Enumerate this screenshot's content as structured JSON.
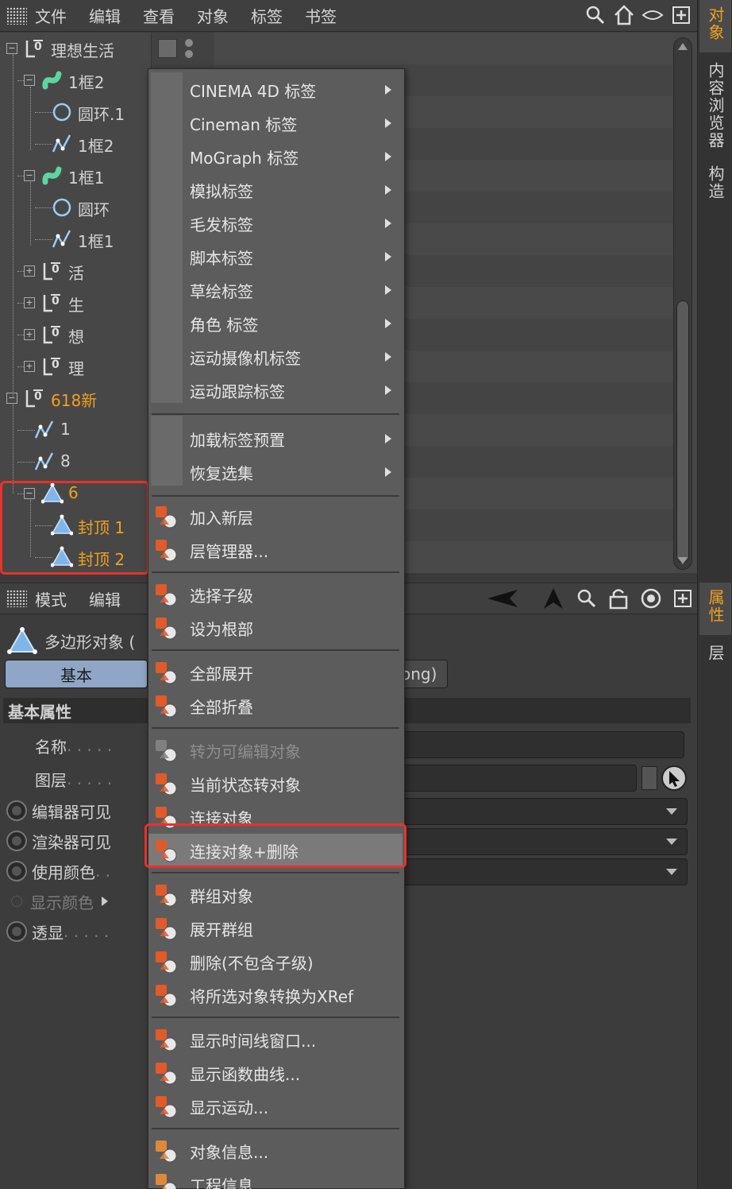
{
  "menubar": {
    "items": [
      "文件",
      "编辑",
      "查看",
      "对象",
      "标签",
      "书签"
    ],
    "icons": [
      "search-icon",
      "home-icon",
      "eye-icon",
      "new-window-icon"
    ]
  },
  "right_tabs": {
    "top": [
      {
        "label": "对象",
        "active": true
      },
      {
        "label": "内容浏览器",
        "active": false
      },
      {
        "label": "构造",
        "active": false
      }
    ],
    "bottom": [
      {
        "label": "属性",
        "active": true
      },
      {
        "label": "层",
        "active": false
      }
    ]
  },
  "object_tree": [
    {
      "label": "理想生活",
      "icon": "null-icon",
      "orange": false
    },
    {
      "label": "1框2",
      "icon": "sweep-icon",
      "orange": false
    },
    {
      "label": "圆环.1",
      "icon": "circle-icon",
      "orange": false
    },
    {
      "label": "1框2",
      "icon": "spline-icon",
      "orange": false
    },
    {
      "label": "1框1",
      "icon": "sweep-icon",
      "orange": false
    },
    {
      "label": "圆环",
      "icon": "circle-icon",
      "orange": false
    },
    {
      "label": "1框1",
      "icon": "spline-icon",
      "orange": false
    },
    {
      "label": "活",
      "icon": "null-icon",
      "orange": false
    },
    {
      "label": "生",
      "icon": "null-icon",
      "orange": false
    },
    {
      "label": "想",
      "icon": "null-icon",
      "orange": false
    },
    {
      "label": "理",
      "icon": "null-icon",
      "orange": false
    },
    {
      "label": "618新",
      "icon": "null-icon",
      "orange": true
    },
    {
      "label": "1",
      "icon": "spline-icon",
      "orange": false
    },
    {
      "label": "8",
      "icon": "spline-icon",
      "orange": false
    },
    {
      "label": "6",
      "icon": "polygon-icon",
      "orange": true
    },
    {
      "label": "封顶 1",
      "icon": "polygon-icon",
      "orange": true
    },
    {
      "label": "封顶 2",
      "icon": "polygon-icon",
      "orange": true
    }
  ],
  "attr_header": {
    "items": [
      "模式",
      "编辑"
    ]
  },
  "attributes": {
    "title": "多边形对象 (",
    "tab_basic": "基本",
    "tab_phong": "ong)",
    "section": "基本属性",
    "rows": [
      {
        "label": "名称",
        "dots": " . . . . ."
      },
      {
        "label": "图层",
        "dots": " . . . . ."
      },
      {
        "label": "编辑器可见",
        "dots": ""
      },
      {
        "label": "渲染器可见",
        "dots": ""
      },
      {
        "label": "使用颜色",
        "dots": " . ."
      },
      {
        "label": "显示颜色",
        "dots": ""
      },
      {
        "label": "透显",
        "dots": " . . . . ."
      }
    ]
  },
  "context_menu": {
    "group1": [
      "CINEMA 4D 标签",
      "Cineman 标签",
      "MoGraph 标签",
      "模拟标签",
      "毛发标签",
      "脚本标签",
      "草绘标签",
      "角色 标签",
      "运动摄像机标签",
      "运动跟踪标签"
    ],
    "group2": [
      "加载标签预置",
      "恢复选集"
    ],
    "group3": [
      {
        "label": "加入新层",
        "icon": "add-layer-icon"
      },
      {
        "label": "层管理器...",
        "icon": "layer-manager-icon"
      }
    ],
    "group4": [
      {
        "label": "选择子级",
        "icon": "select-children-icon"
      },
      {
        "label": "设为根部",
        "icon": "set-root-icon"
      }
    ],
    "group5": [
      {
        "label": "全部展开",
        "icon": "expand-all-icon"
      },
      {
        "label": "全部折叠",
        "icon": "collapse-all-icon"
      }
    ],
    "group6": [
      {
        "label": "转为可编辑对象",
        "icon": "make-editable-icon",
        "disabled": true
      },
      {
        "label": "当前状态转对象",
        "icon": "current-state-icon",
        "disabled": false
      },
      {
        "label": "连接对象",
        "icon": "connect-icon",
        "disabled": false
      },
      {
        "label": "连接对象+删除",
        "icon": "connect-delete-icon",
        "disabled": false
      }
    ],
    "group7": [
      {
        "label": "群组对象",
        "icon": "group-icon"
      },
      {
        "label": "展开群组",
        "icon": "expand-group-icon"
      },
      {
        "label": "删除(不包含子级)",
        "icon": "delete-no-children-icon"
      },
      {
        "label": "将所选对象转换为XRef",
        "icon": "xref-icon"
      }
    ],
    "group8": [
      {
        "label": "显示时间线窗口...",
        "icon": "timeline-icon"
      },
      {
        "label": "显示函数曲线...",
        "icon": "f-curve-icon"
      },
      {
        "label": "显示运动...",
        "icon": "motion-icon"
      }
    ],
    "group9": [
      {
        "label": "对象信息...",
        "icon": "object-info-icon"
      },
      {
        "label": "工程信息...",
        "icon": "project-info-icon"
      }
    ]
  },
  "colors": {
    "accent_orange": "#f0a020",
    "highlight_red": "#e8322a",
    "tab_blue": "#8fa6c6"
  }
}
